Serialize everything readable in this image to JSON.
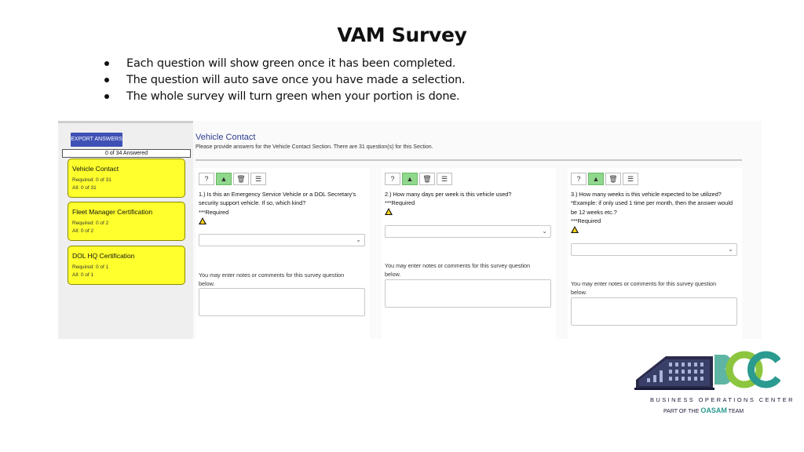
{
  "title": "VAM Survey",
  "bullets": [
    "Each question will show green once it has been completed.",
    "The question will auto save once you have made a selection.",
    "The whole survey will turn green when your portion is done."
  ],
  "sidebar": {
    "export_label": "EXPORT ANSWERS",
    "answered_count": "0 of 34 Answered",
    "sections": [
      {
        "title": "Vehicle Contact",
        "required": "Required: 0 of 31",
        "all": "All: 0 of 31"
      },
      {
        "title": "Fleet Manager Certification",
        "required": "Required: 0 of 2",
        "all": "All: 0 of 2"
      },
      {
        "title": "DOL HQ Certification",
        "required": "Required: 0 of 1",
        "all": "All: 0 of 1"
      }
    ]
  },
  "content": {
    "title": "Vehicle Contact",
    "description": "Please provide answers for the Vehicle Contact Section. There are 31 question(s) for this Section.",
    "toolbar_icons": [
      "help-icon",
      "warning-icon",
      "trash-icon",
      "list-icon"
    ],
    "questions": [
      {
        "text": "1.)  Is this an Emergency Service Vehicle or a DOL Secretary's security support vehicle. If so, which kind?",
        "required": "***Required",
        "select_value": "",
        "notes_label": "You may enter notes or comments for this survey question below."
      },
      {
        "text": "2.)  How many days per week is this vehicle used?",
        "required": "***Required",
        "select_value": "",
        "notes_label": "You may enter notes or comments for this survey question below."
      },
      {
        "text": "3.)  How many weeks is this vehicle expected to be utilized? *Example: if only used 1 time per month, then the answer would be 12 weeks etc.?",
        "required": "***Required",
        "select_value": "",
        "notes_label": "You may enter notes or comments for this survey question below."
      }
    ]
  },
  "logo": {
    "brand": "BOC",
    "tagline": "BUSINESS OPERATIONS CENTER",
    "part_of": "PART OF THE",
    "oasam": "OASAM",
    "team": "TEAM"
  },
  "colors": {
    "section_yellow": "#ffff2e",
    "export_blue": "#3f51b5",
    "toolbar_green": "#8fd88c",
    "heading_blue": "#2d3e8f",
    "logo_teal": "#2b9a8f",
    "logo_green": "#8cc63f"
  }
}
